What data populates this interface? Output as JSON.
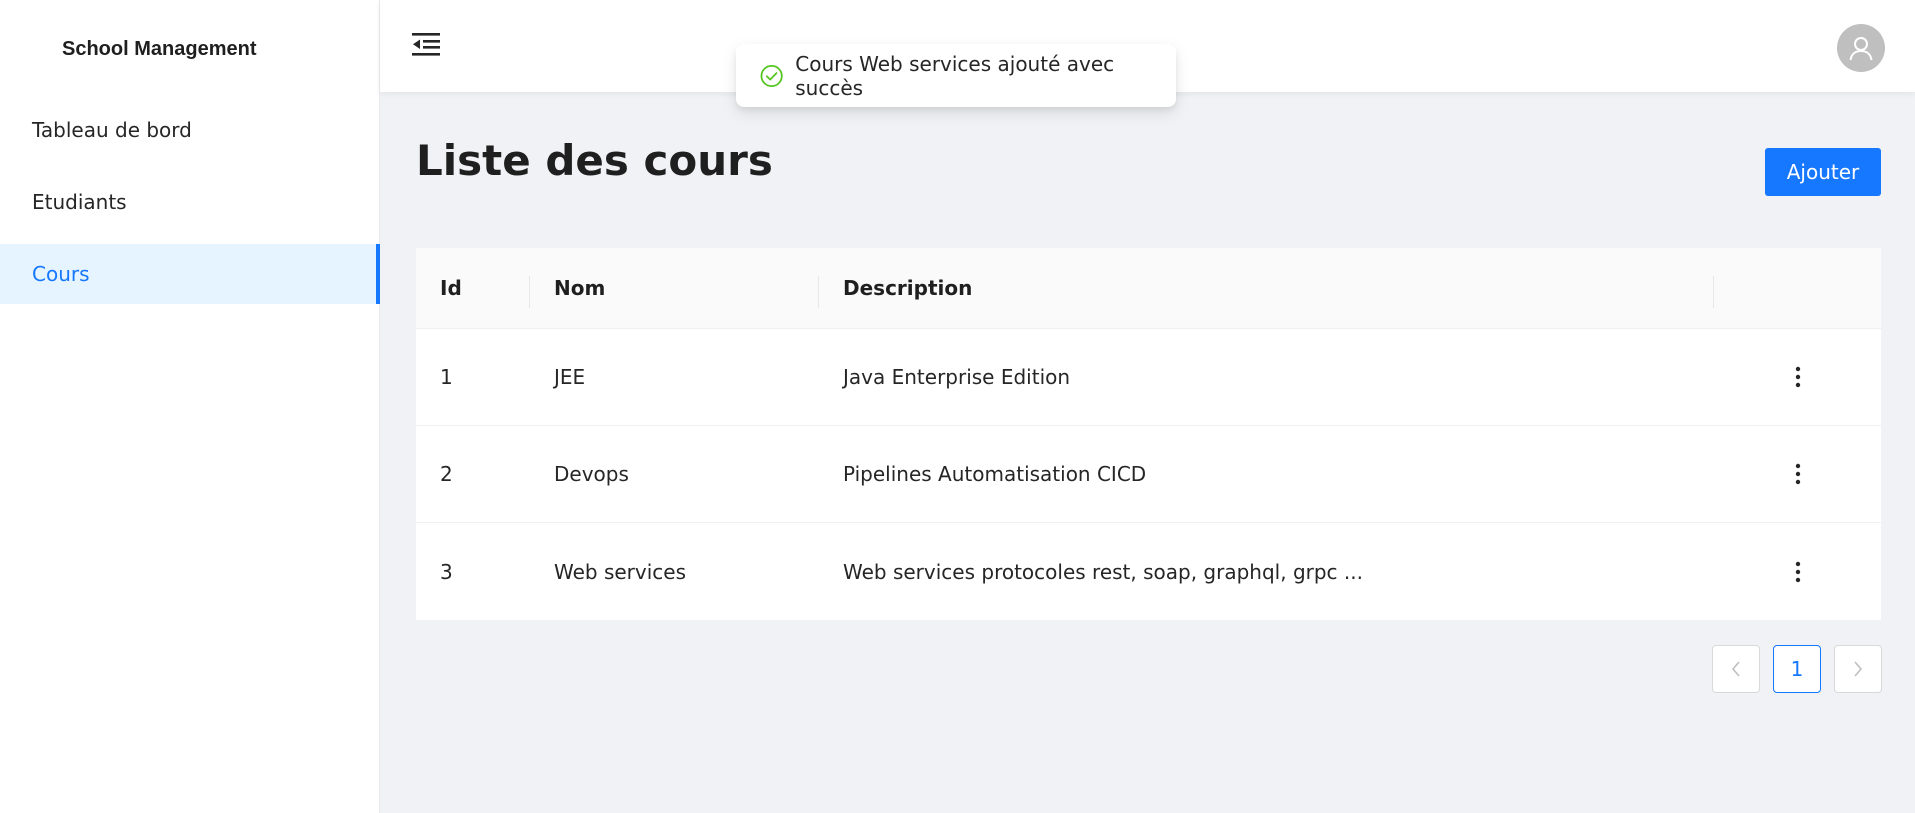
{
  "brand": {
    "title": "School Management"
  },
  "sidebar": {
    "items": [
      {
        "label": "Tableau de bord"
      },
      {
        "label": "Etudiants"
      },
      {
        "label": "Cours"
      }
    ]
  },
  "toast": {
    "message": "Cours Web services ajouté avec succès"
  },
  "page": {
    "title": "Liste des cours",
    "add_label": "Ajouter"
  },
  "table": {
    "headers": [
      "Id",
      "Nom",
      "Description",
      ""
    ],
    "rows": [
      {
        "id": "1",
        "nom": "JEE",
        "description": "Java Enterprise Edition"
      },
      {
        "id": "2",
        "nom": "Devops",
        "description": "Pipelines Automatisation CICD"
      },
      {
        "id": "3",
        "nom": "Web services",
        "description": "Web services protocoles rest, soap, graphql, grpc ..."
      }
    ]
  },
  "pagination": {
    "current": "1"
  },
  "colors": {
    "primary": "#1677ff",
    "success": "#52c41a",
    "active_bg": "#e6f4ff"
  },
  "icons": {
    "menu": "menu-fold-icon",
    "avatar": "user-icon",
    "toast": "check-circle-icon",
    "row_action": "more-vertical-icon",
    "prev": "chevron-left-icon",
    "next": "chevron-right-icon"
  }
}
